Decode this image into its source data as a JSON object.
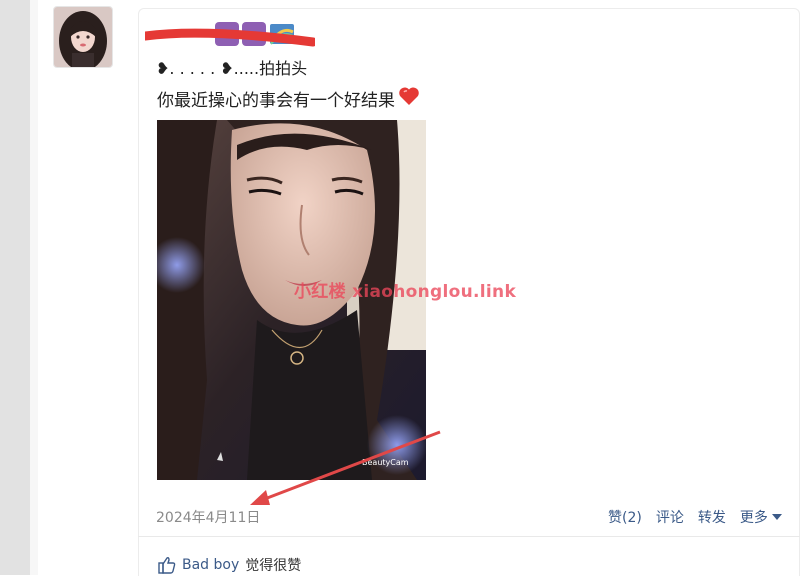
{
  "post": {
    "line1": "❥. . . . . ❥.....拍拍头",
    "line2": "你最近操心的事会有一个好结果",
    "photo_caption": "BeautyCam",
    "watermark": "小红楼 xiaohonglou.link",
    "date": "2024年4月11日"
  },
  "actions": {
    "like": "赞(2)",
    "comment": "评论",
    "repost": "转发",
    "more": "更多"
  },
  "likes": {
    "user": "Bad boy",
    "suffix": "觉得很赞"
  },
  "colors": {
    "accent": "#3b5a88",
    "watermark": "#eb465a",
    "redaction": "#e53935",
    "arrow": "#e04848"
  }
}
